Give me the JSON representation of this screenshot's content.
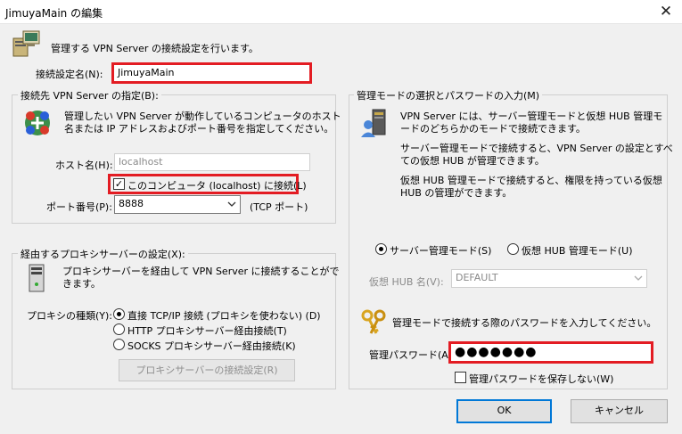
{
  "window": {
    "title": "JimuyaMain の編集",
    "close_glyph": "✕"
  },
  "header": {
    "description": "管理する VPN Server の接続設定を行います。"
  },
  "setting_name": {
    "label": "接続設定名(N):",
    "value": "JimuyaMain"
  },
  "server_group": {
    "title": "接続先 VPN Server の指定(B):",
    "description_line1": "管理したい VPN Server が動作しているコンピュータのホスト",
    "description_line2": "名または IP アドレスおよびポート番号を指定してください。",
    "host_label": "ホスト名(H):",
    "host_value": "localhost",
    "localhost_check_label": "このコンピュータ (localhost) に接続(L)",
    "localhost_checked": true,
    "port_label": "ポート番号(P):",
    "port_value": "8888",
    "port_suffix": "(TCP ポート)"
  },
  "proxy_group": {
    "title": "経由するプロキシサーバーの設定(X):",
    "description_line1": "プロキシサーバーを経由して VPN Server に接続することがで",
    "description_line2": "きます。",
    "type_label": "プロキシの種類(Y):",
    "options": [
      {
        "label": "直接 TCP/IP 接続 (プロキシを使わない) (D)",
        "selected": true
      },
      {
        "label": "HTTP プロキシサーバー経由接続(T)",
        "selected": false
      },
      {
        "label": "SOCKS プロキシサーバー経由接続(K)",
        "selected": false
      }
    ],
    "settings_button": "プロキシサーバーの接続設定(R)"
  },
  "mode_group": {
    "title": "管理モードの選択とパスワードの入力(M)",
    "desc1_line1": "VPN Server には、サーバー管理モードと仮想 HUB 管理モ",
    "desc1_line2": "ードのどちらかのモードで接続できます。",
    "desc2_line1": "サーバー管理モードで接続すると、VPN Server の設定とすべ",
    "desc2_line2": "ての仮想 HUB が管理できます。",
    "desc3_line1": "仮想 HUB 管理モードで接続すると、権限を持っている仮想",
    "desc3_line2": "HUB の管理ができます。",
    "server_mode_label": "サーバー管理モード(S)",
    "hub_mode_label": "仮想 HUB 管理モード(U)",
    "selected_mode": "server",
    "hub_name_label": "仮想 HUB 名(V):",
    "hub_name_value": "DEFAULT",
    "password_prompt": "管理モードで接続する際のパスワードを入力してください。",
    "password_label": "管理パスワード(A):",
    "password_value": "●●●●●●●",
    "no_save_label": "管理パスワードを保存しない(W)",
    "no_save_checked": false
  },
  "buttons": {
    "ok": "OK",
    "cancel": "キャンセル"
  },
  "colors": {
    "highlight": "#e31c23",
    "default_button_border": "#0078d7"
  }
}
